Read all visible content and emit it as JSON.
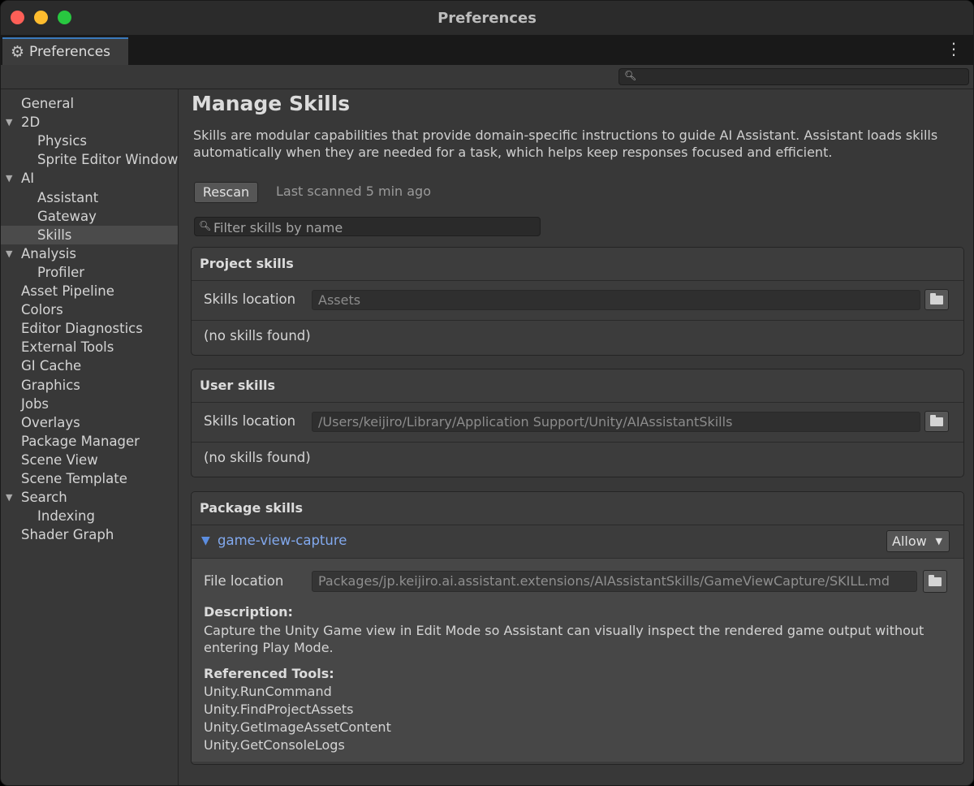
{
  "window": {
    "title": "Preferences"
  },
  "tab": {
    "label": "Preferences",
    "icon": "gear-icon"
  },
  "sidebar": {
    "items": [
      {
        "label": "General",
        "level": 0
      },
      {
        "label": "2D",
        "level": 0,
        "expandable": true
      },
      {
        "label": "Physics",
        "level": 1
      },
      {
        "label": "Sprite Editor Window",
        "level": 1
      },
      {
        "label": "AI",
        "level": 0,
        "expandable": true
      },
      {
        "label": "Assistant",
        "level": 1
      },
      {
        "label": "Gateway",
        "level": 1
      },
      {
        "label": "Skills",
        "level": 1,
        "selected": true
      },
      {
        "label": "Analysis",
        "level": 0,
        "expandable": true
      },
      {
        "label": "Profiler",
        "level": 1
      },
      {
        "label": "Asset Pipeline",
        "level": 0
      },
      {
        "label": "Colors",
        "level": 0
      },
      {
        "label": "Editor Diagnostics",
        "level": 0
      },
      {
        "label": "External Tools",
        "level": 0
      },
      {
        "label": "GI Cache",
        "level": 0
      },
      {
        "label": "Graphics",
        "level": 0
      },
      {
        "label": "Jobs",
        "level": 0
      },
      {
        "label": "Overlays",
        "level": 0
      },
      {
        "label": "Package Manager",
        "level": 0
      },
      {
        "label": "Scene View",
        "level": 0
      },
      {
        "label": "Scene Template",
        "level": 0
      },
      {
        "label": "Search",
        "level": 0,
        "expandable": true
      },
      {
        "label": "Indexing",
        "level": 1
      },
      {
        "label": "Shader Graph",
        "level": 0
      }
    ]
  },
  "main": {
    "title": "Manage Skills",
    "description": "Skills are modular capabilities that provide domain-specific instructions to guide AI Assistant. Assistant loads skills automatically when they are needed for a task, which helps keep responses focused and efficient.",
    "rescan_label": "Rescan",
    "last_scanned": "Last scanned 5 min ago",
    "filter_placeholder": "Filter skills by name",
    "project": {
      "title": "Project skills",
      "location_label": "Skills location",
      "location_value": "Assets",
      "empty": "(no skills found)"
    },
    "user": {
      "title": "User skills",
      "location_label": "Skills location",
      "location_value": "/Users/keijiro/Library/Application Support/Unity/AIAssistantSkills",
      "empty": "(no skills found)"
    },
    "package": {
      "title": "Package skills",
      "skill": {
        "name": "game-view-capture",
        "permission": "Allow",
        "file_label": "File location",
        "file_value": "Packages/jp.keijiro.ai.assistant.extensions/AIAssistantSkills/GameViewCapture/SKILL.md",
        "description_label": "Description:",
        "description": "Capture the Unity Game view in Edit Mode so Assistant can visually inspect the rendered game output without entering Play Mode.",
        "tools_label": "Referenced Tools:",
        "tools": [
          "Unity.RunCommand",
          "Unity.FindProjectAssets",
          "Unity.GetImageAssetContent",
          "Unity.GetConsoleLogs"
        ]
      }
    }
  },
  "colors": {
    "accent": "#3a79bb",
    "link": "#82a9ee",
    "background": "#383838"
  }
}
